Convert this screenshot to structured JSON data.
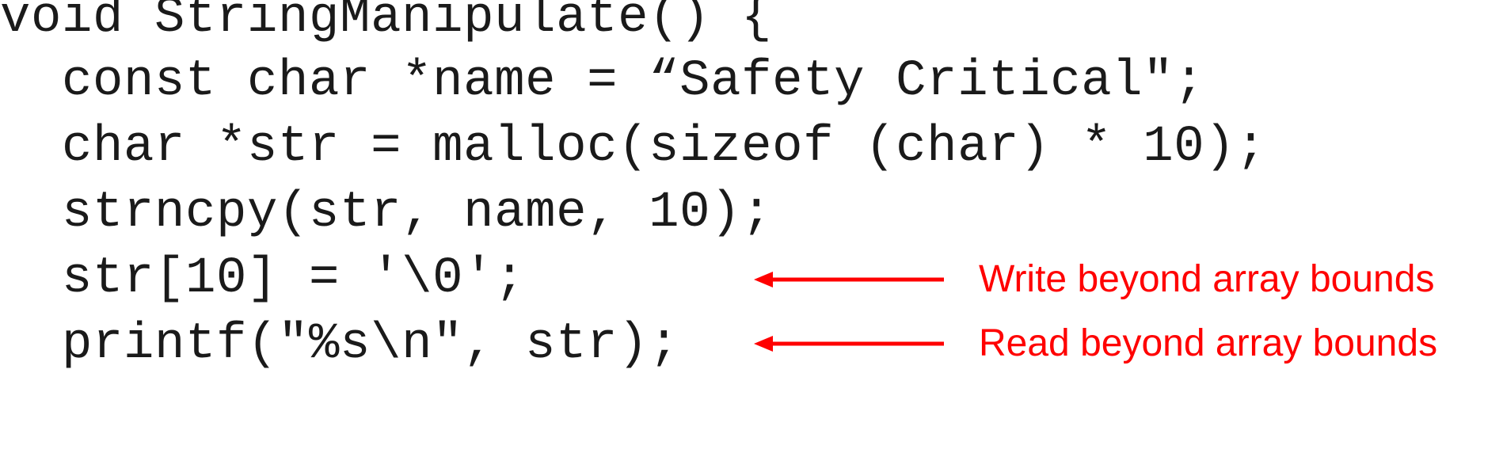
{
  "code": {
    "lines": [
      "void StringManipulate() {",
      "  const char *name = “Safety Critical\";",
      "  char *str = malloc(sizeof (char) * 10);",
      "  strncpy(str, name, 10);",
      "  str[10] = '\\0';",
      "  printf(\"%s\\n\", str);"
    ]
  },
  "annotations": {
    "write": {
      "text": "Write beyond array bounds",
      "color": "#ff0000",
      "icon": "left-arrow-icon"
    },
    "read": {
      "text": "Read beyond array bounds",
      "color": "#ff0000",
      "icon": "left-arrow-icon"
    }
  }
}
